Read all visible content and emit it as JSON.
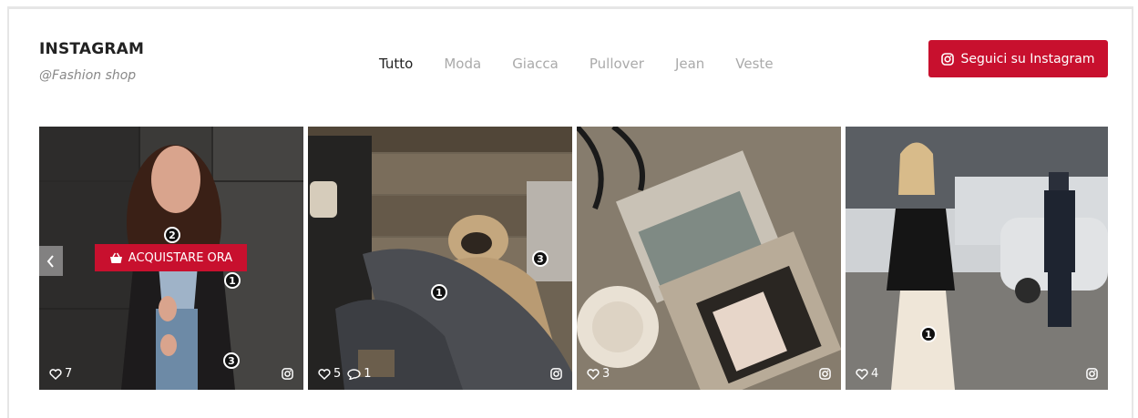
{
  "header": {
    "title": "INSTAGRAM",
    "subtitle": "@Fashion shop",
    "follow_label": "Seguici su Instagram"
  },
  "tabs": [
    {
      "label": "Tutto",
      "active": true
    },
    {
      "label": "Moda",
      "active": false
    },
    {
      "label": "Giacca",
      "active": false
    },
    {
      "label": "Pullover",
      "active": false
    },
    {
      "label": "Jean",
      "active": false
    },
    {
      "label": "Veste",
      "active": false
    }
  ],
  "posts": [
    {
      "likes": "7",
      "comments": null,
      "hotspots": [
        "2",
        "1",
        "3"
      ],
      "buy_label": "ACQUISTARE ORA"
    },
    {
      "likes": "5",
      "comments": "1",
      "hotspots": [
        "1",
        "3"
      ]
    },
    {
      "likes": "3",
      "comments": null,
      "hotspots": []
    },
    {
      "likes": "4",
      "comments": null,
      "hotspots": [
        "1"
      ]
    }
  ],
  "colors": {
    "accent": "#c8102e",
    "tab_active": "#222222",
    "tab_inactive": "#aaaaaa",
    "subtitle": "#888888"
  },
  "icons": {
    "follow_button": "instagram-icon",
    "buy_button": "shopping-basket-icon",
    "likes": "heart-icon",
    "comments": "comment-icon",
    "carousel_prev": "chevron-left-icon"
  }
}
